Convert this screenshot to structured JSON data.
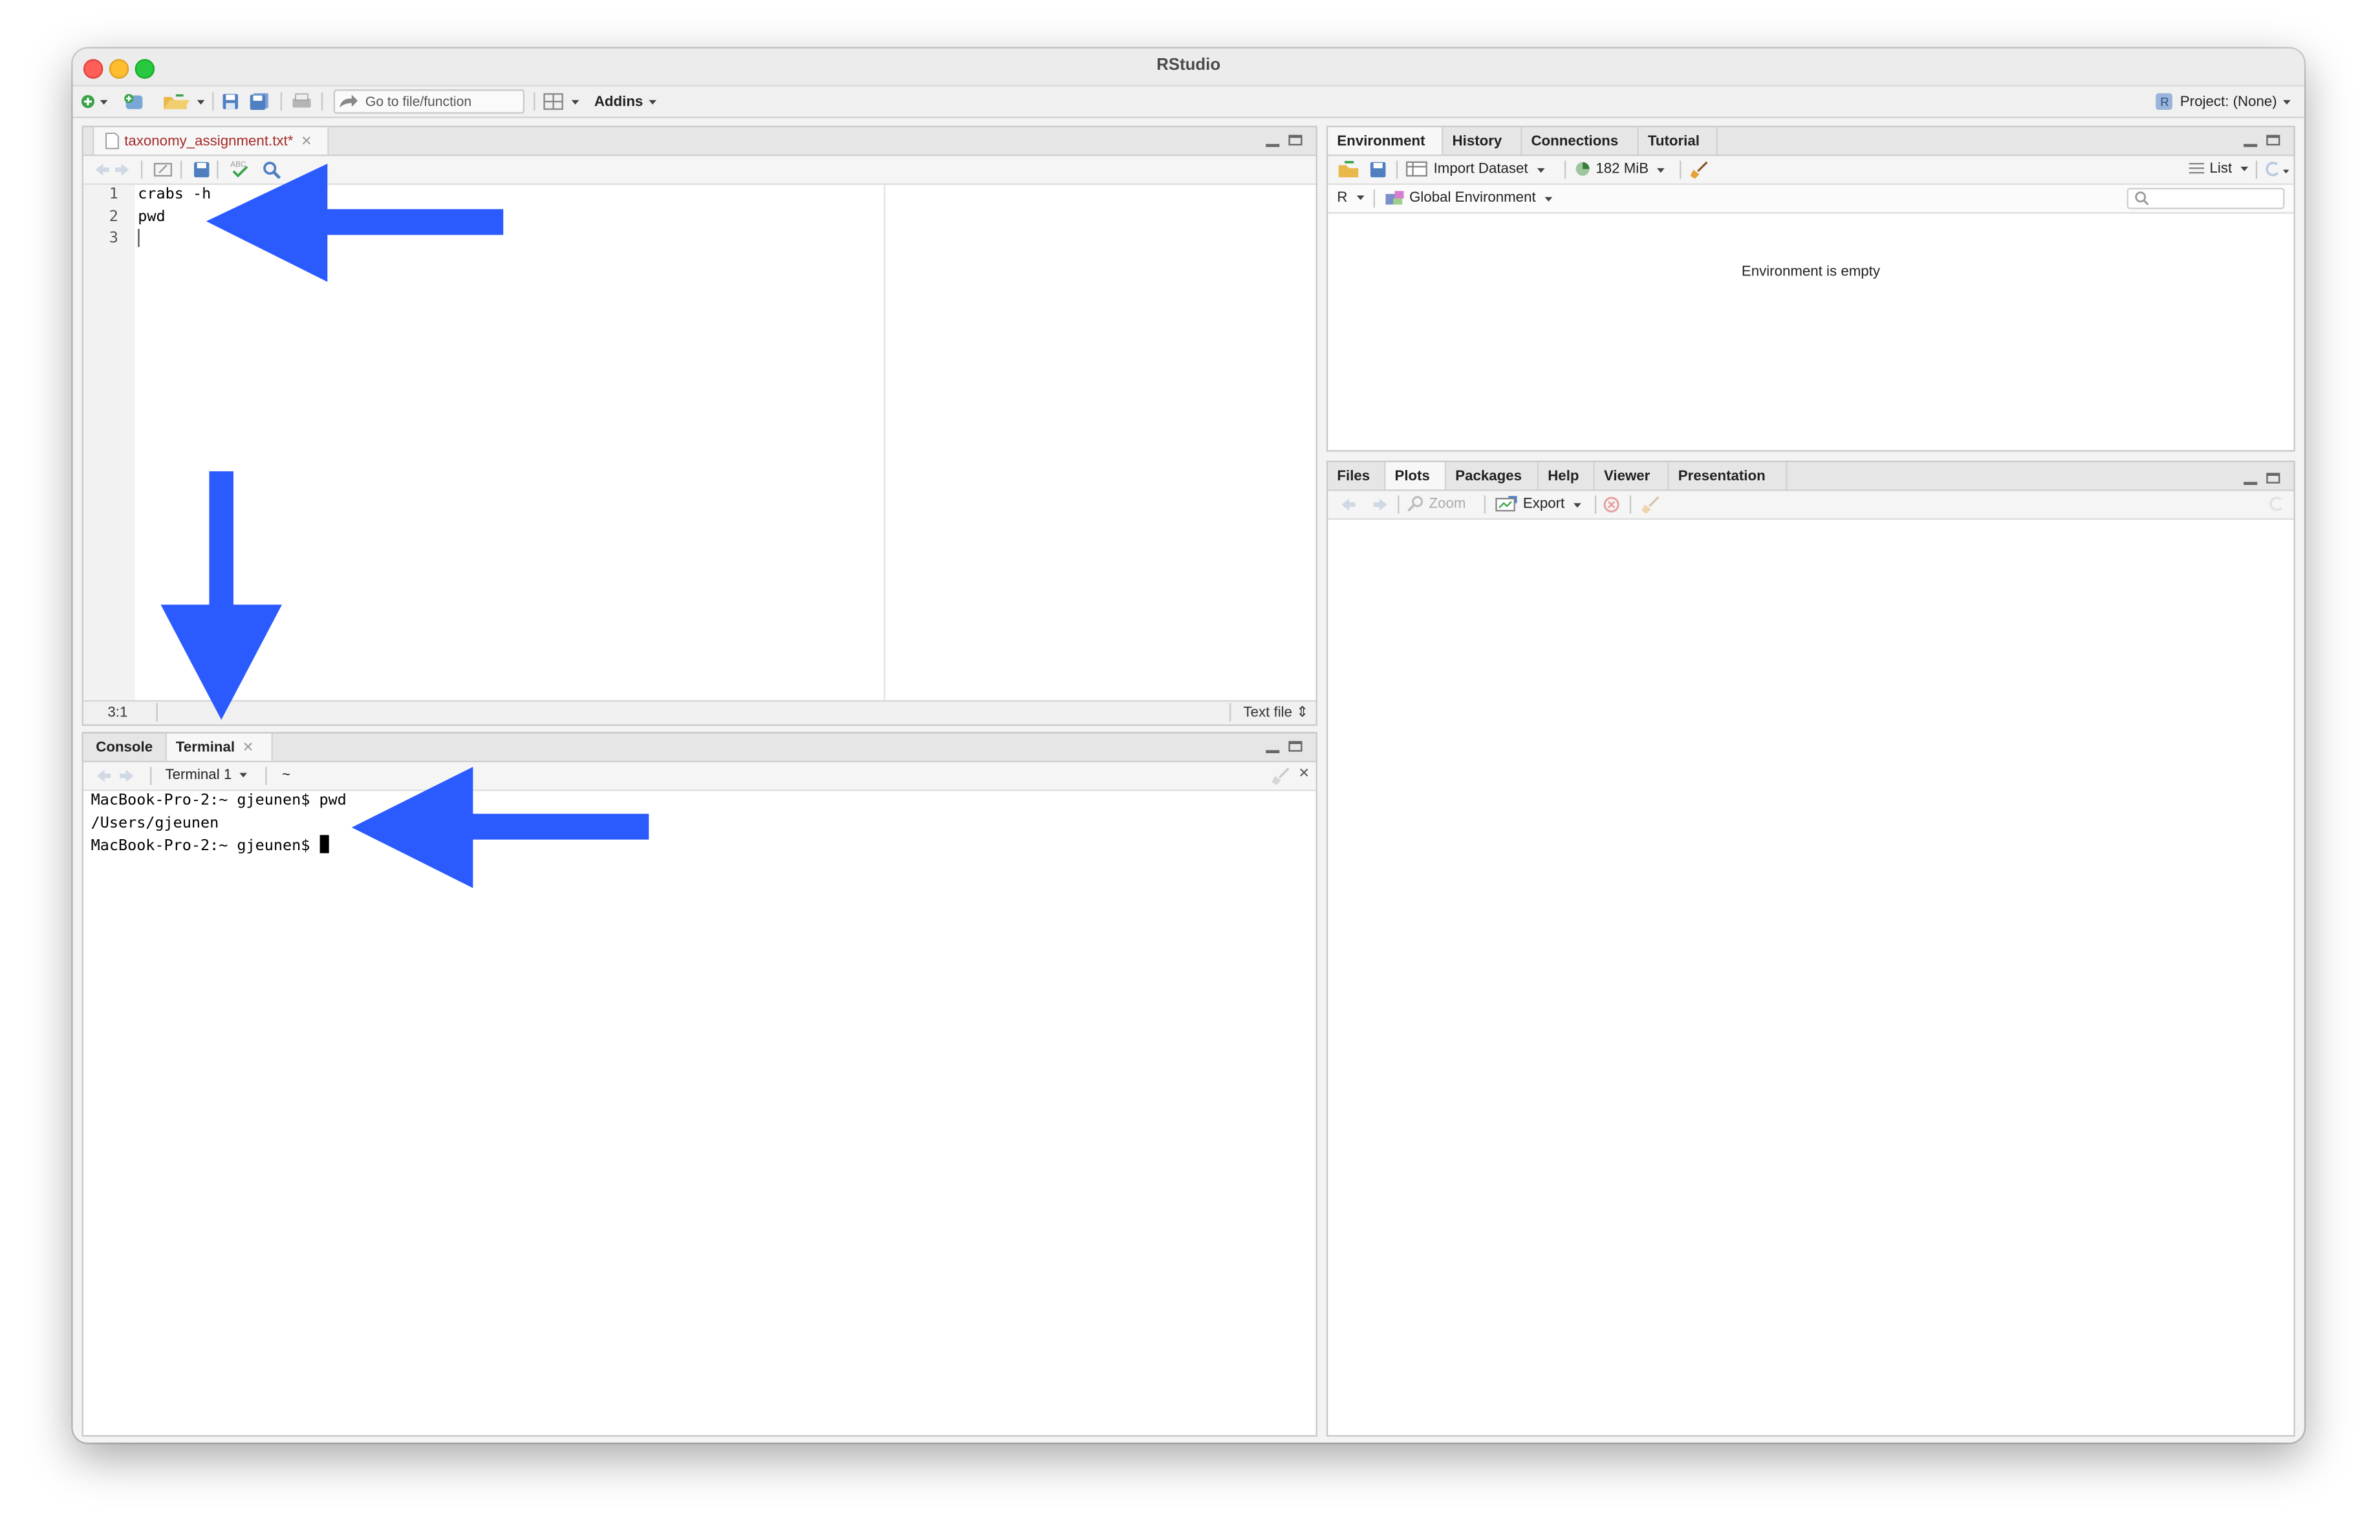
{
  "window": {
    "title": "RStudio"
  },
  "toolbar": {
    "goto_placeholder": "Go to file/function",
    "addins_label": "Addins",
    "project_label": "Project: (None)"
  },
  "editor": {
    "tab_label": "taxonomy_assignment.txt*",
    "lines": [
      "crabs -h",
      "pwd",
      ""
    ],
    "line_numbers": [
      "1",
      "2",
      "3"
    ],
    "cursor_pos": "3:1",
    "file_type": "Text file"
  },
  "console_pane": {
    "tabs": [
      "Console",
      "Terminal"
    ],
    "terminal_selector": "Terminal 1",
    "terminal_dir": "~",
    "output": [
      "MacBook-Pro-2:~ gjeunen$ pwd",
      "/Users/gjeunen",
      "MacBook-Pro-2:~ gjeunen$ "
    ]
  },
  "env_pane": {
    "tabs": [
      "Environment",
      "History",
      "Connections",
      "Tutorial"
    ],
    "import_label": "Import Dataset",
    "memory_label": "182 MiB",
    "list_label": "List",
    "lang_label": "R",
    "env_label": "Global Environment",
    "empty_msg": "Environment is empty"
  },
  "files_pane": {
    "tabs": [
      "Files",
      "Plots",
      "Packages",
      "Help",
      "Viewer",
      "Presentation"
    ],
    "zoom_label": "Zoom",
    "export_label": "Export"
  },
  "colors": {
    "arrow": "#2b5bff",
    "tab_file_text": "#a52a2a"
  }
}
